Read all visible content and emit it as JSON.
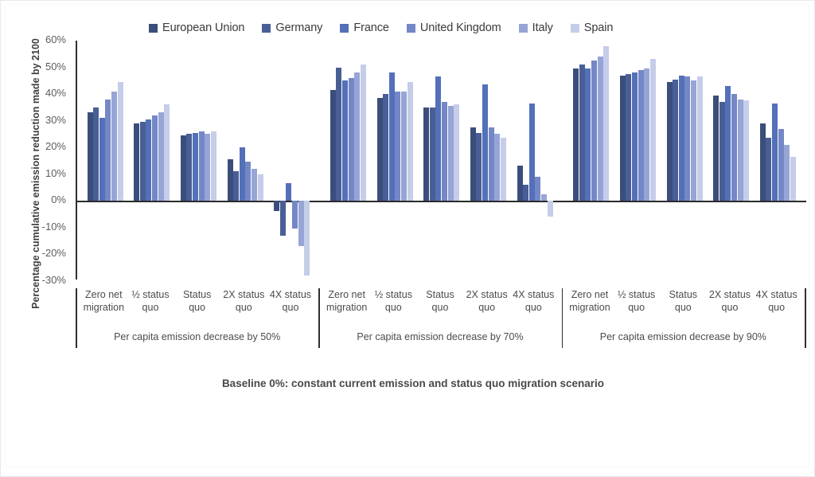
{
  "chart_data": {
    "type": "bar",
    "title": "",
    "caption": "Baseline 0%: constant current emission and status quo migration scenario",
    "ylabel": "Percentage cumulative emission reduction made by 2100",
    "xlabel": "",
    "ylim": [
      -30,
      60
    ],
    "ytick_labels": [
      "60%",
      "50%",
      "40%",
      "30%",
      "20%",
      "10%",
      "0%",
      "-10%",
      "-20%",
      "-30%"
    ],
    "ytick_values": [
      60,
      50,
      40,
      30,
      20,
      10,
      0,
      -10,
      -20,
      -30
    ],
    "grid": false,
    "legend_position": "top",
    "legend": [
      "European Union",
      "Germany",
      "France",
      "United Kingdom",
      "Italy",
      "Spain"
    ],
    "series_colors": [
      "#3b4e7b",
      "#4a5e96",
      "#5370b8",
      "#7487c6",
      "#96a4d6",
      "#c5cde9"
    ],
    "categories": [
      "Zero net migration",
      "½ status quo",
      "Status quo",
      "2X status quo",
      "4X status quo"
    ],
    "groups": [
      {
        "label": "Per capita emission decrease by 50%",
        "categories": [
          "Zero net migration",
          "½ status quo",
          "Status quo",
          "2X status quo",
          "4X status quo"
        ],
        "series": [
          {
            "name": "European Union",
            "values": [
              33,
              29,
              24.5,
              15.5,
              -4
            ]
          },
          {
            "name": "Germany",
            "values": [
              35,
              29.5,
              25,
              11,
              -13
            ]
          },
          {
            "name": "France",
            "values": [
              31,
              30.5,
              25.5,
              20,
              6.5
            ]
          },
          {
            "name": "United Kingdom",
            "values": [
              38,
              32,
              26,
              14.5,
              -10.5
            ]
          },
          {
            "name": "Italy",
            "values": [
              41,
              33,
              25,
              12,
              -17
            ]
          },
          {
            "name": "Spain",
            "values": [
              44.5,
              36,
              26,
              10,
              -28
            ]
          }
        ]
      },
      {
        "label": "Per capita emission decrease by 70%",
        "categories": [
          "Zero net migration",
          "½ status quo",
          "Status quo",
          "2X status quo",
          "4X status quo"
        ],
        "series": [
          {
            "name": "European Union",
            "values": [
              41.5,
              38.5,
              35,
              27.5,
              13
            ]
          },
          {
            "name": "Germany",
            "values": [
              50,
              40,
              35,
              25.5,
              6
            ]
          },
          {
            "name": "France",
            "values": [
              45,
              48,
              46.5,
              43.5,
              36.5
            ]
          },
          {
            "name": "United Kingdom",
            "values": [
              46,
              41,
              37,
              27.5,
              9
            ]
          },
          {
            "name": "Italy",
            "values": [
              48,
              41,
              35.5,
              25,
              2.5
            ]
          },
          {
            "name": "Spain",
            "values": [
              51,
              44.5,
              36,
              23.5,
              -6
            ]
          }
        ]
      },
      {
        "label": "Per capita emission decrease by 90%",
        "categories": [
          "Zero net migration",
          "½ status quo",
          "Status quo",
          "2X status quo",
          "4X status quo"
        ],
        "series": [
          {
            "name": "European Union",
            "values": [
              49.5,
              47,
              44.5,
              39.5,
              29
            ]
          },
          {
            "name": "Germany",
            "values": [
              51,
              47.5,
              45.5,
              37,
              23.5
            ]
          },
          {
            "name": "France",
            "values": [
              49.5,
              48,
              47,
              43,
              36.5
            ]
          },
          {
            "name": "United Kingdom",
            "values": [
              52.5,
              49,
              46.5,
              40,
              27
            ]
          },
          {
            "name": "Italy",
            "values": [
              54,
              49.5,
              45,
              38,
              21
            ]
          },
          {
            "name": "Spain",
            "values": [
              58,
              53,
              46.5,
              37.5,
              16.5
            ]
          }
        ]
      }
    ]
  }
}
